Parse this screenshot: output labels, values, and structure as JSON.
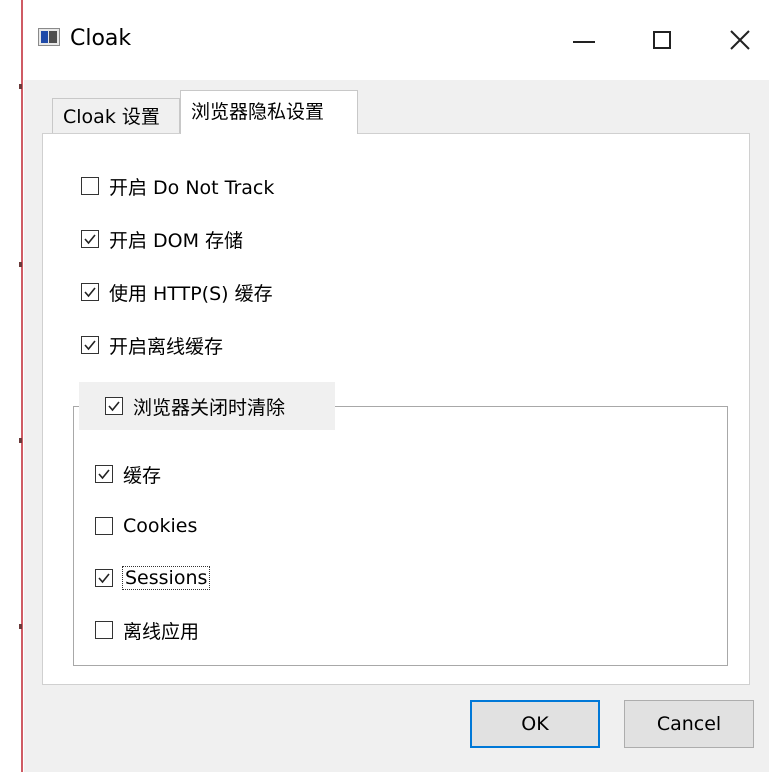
{
  "window": {
    "title": "Cloak",
    "controls": {
      "minimize": "minimize-icon",
      "maximize": "maximize-icon",
      "close": "close-icon"
    }
  },
  "tabs": [
    {
      "label": "Cloak 设置",
      "selected": false
    },
    {
      "label": "浏览器隐私设置",
      "selected": true
    }
  ],
  "options": [
    {
      "label": "开启 Do Not Track",
      "checked": false
    },
    {
      "label": "开启 DOM 存储",
      "checked": true
    },
    {
      "label": "使用 HTTP(S) 缓存",
      "checked": true
    },
    {
      "label": "开启离线缓存",
      "checked": true
    }
  ],
  "clear_group": {
    "label": "浏览器关闭时清除",
    "checked": true,
    "items": [
      {
        "label": "缓存",
        "checked": true
      },
      {
        "label": "Cookies",
        "checked": false
      },
      {
        "label": "Sessions",
        "checked": true,
        "focused": true
      },
      {
        "label": "离线应用",
        "checked": false
      }
    ]
  },
  "buttons": {
    "ok": "OK",
    "cancel": "Cancel"
  },
  "colors": {
    "accent": "#0078d7",
    "panel": "#ffffff",
    "window_bg": "#f0f0f0"
  }
}
